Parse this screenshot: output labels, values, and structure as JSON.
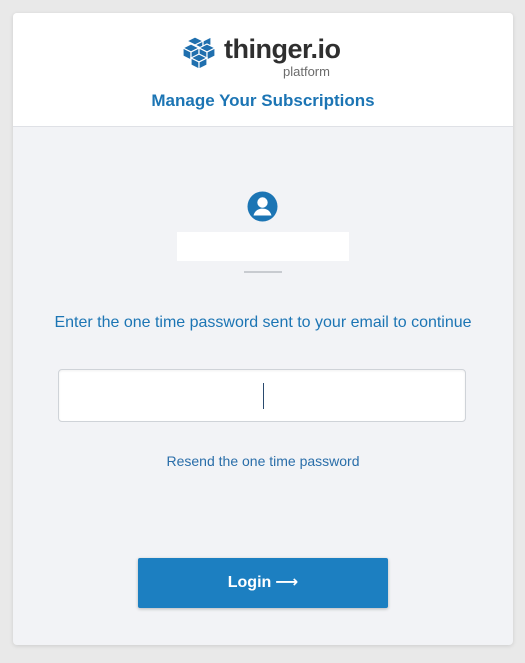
{
  "brand": {
    "name": "thinger.io",
    "tagline": "platform",
    "logo_icon": "cubes-logo-icon"
  },
  "header": {
    "title": "Manage Your Subscriptions"
  },
  "account": {
    "icon": "user-circle-icon",
    "username": ""
  },
  "form": {
    "instruction": "Enter the one time password sent to your email to continue",
    "otp_value": "",
    "resend_label": "Resend the one time password",
    "login_label": "Login",
    "login_arrow": "⟶"
  },
  "colors": {
    "accent": "#1c75b4",
    "button": "#1c7fc1",
    "card_bg": "#f2f3f6",
    "header_bg": "#ffffff"
  }
}
